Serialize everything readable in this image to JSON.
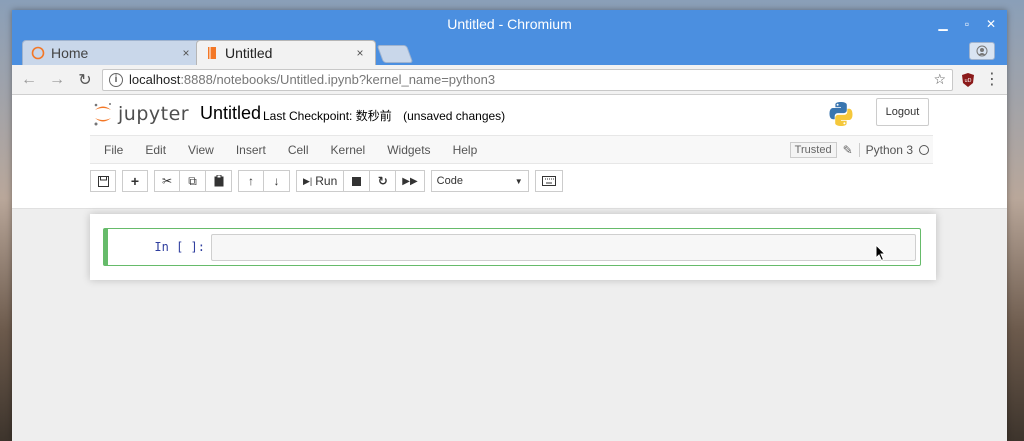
{
  "window": {
    "title": "Untitled - Chromium"
  },
  "tabs": [
    {
      "title": "Home",
      "active": false,
      "close": "×"
    },
    {
      "title": "Untitled",
      "active": true,
      "close": "×"
    }
  ],
  "toolbar": {
    "url_host": "localhost",
    "url_rest": ":8888/notebooks/Untitled.ipynb?kernel_name=python3"
  },
  "jupyter": {
    "logo_text": "jupyter",
    "notebook_name": "Untitled",
    "checkpoint_label": "Last Checkpoint:",
    "checkpoint_time": "数秒前",
    "autosave_status": "(unsaved changes)",
    "logout_label": "Logout",
    "menu": [
      "File",
      "Edit",
      "View",
      "Insert",
      "Cell",
      "Kernel",
      "Widgets",
      "Help"
    ],
    "trusted_label": "Trusted",
    "kernel_name": "Python 3",
    "run_label": "Run",
    "cell_type": "Code"
  },
  "cell": {
    "prompt": "In [ ]:",
    "source": ""
  },
  "colors": {
    "titlebar": "#4b8fe0",
    "cell_border": "#66bb6a",
    "jupyter_orange": "#f37726"
  }
}
